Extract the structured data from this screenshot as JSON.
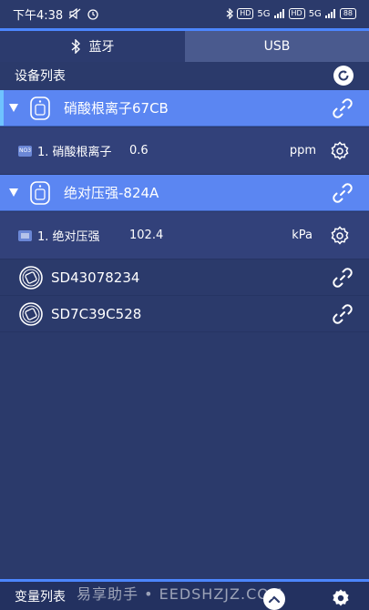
{
  "status_bar": {
    "time": "下午4:38",
    "network_label_1": "HD",
    "network_label_2": "5G",
    "network_label_3": "HD",
    "network_label_4": "5G",
    "battery": "88"
  },
  "tabs": [
    {
      "label": "蓝牙",
      "active": true
    },
    {
      "label": "USB",
      "active": false
    }
  ],
  "device_list": {
    "title": "设备列表"
  },
  "devices": [
    {
      "name": "硝酸根离子67CB",
      "expanded": true,
      "sensor": {
        "badge": "NO3",
        "label": "1. 硝酸根离子",
        "value": "0.6",
        "unit": "ppm"
      }
    },
    {
      "name": "绝对压强-824A",
      "expanded": true,
      "sensor": {
        "badge": "",
        "label": "1. 绝对压强",
        "value": "102.4",
        "unit": "kPa"
      }
    },
    {
      "name": "SD43078234",
      "expanded": false
    },
    {
      "name": "SD7C39C528",
      "expanded": false
    }
  ],
  "footer": {
    "title": "变量列表",
    "watermark": "易享助手 • EEDSHZJZ.COM"
  },
  "colors": {
    "background": "#2b3a6b",
    "row_selected": "#5b86f2",
    "accent": "#4c86ff"
  }
}
